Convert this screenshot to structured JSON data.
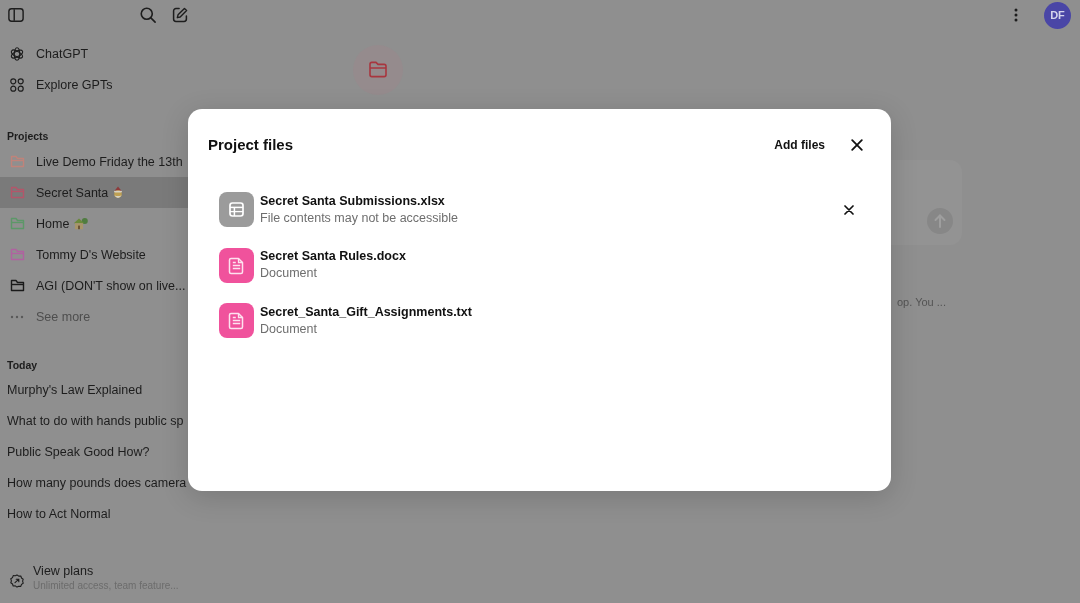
{
  "sidebar": {
    "nav": [
      {
        "label": "ChatGPT",
        "kind": "knot"
      },
      {
        "label": "Explore GPTs",
        "kind": "grid"
      }
    ],
    "projects": {
      "heading": "Projects",
      "items": [
        {
          "name": "Live Demo Friday the 13th",
          "color": "#c0837a",
          "selected": false,
          "kind": "plain"
        },
        {
          "name": "Secret Santa",
          "color": "#b3566a",
          "selected": true,
          "kind": "santa"
        },
        {
          "name": "Home",
          "color": "#5c9868",
          "selected": false,
          "kind": "house"
        },
        {
          "name": "Tommy D's Website",
          "color": "#b062a0",
          "selected": false,
          "kind": "plain"
        },
        {
          "name": "AGI (DON'T show on live...",
          "color": "#1a1a1a",
          "selected": false,
          "kind": "plain"
        }
      ],
      "see_more": "See more"
    },
    "today": {
      "heading": "Today",
      "items": [
        "Murphy's Law Explained",
        "What to do with hands public sp",
        "Public Speak Good How?",
        "How many pounds does camera",
        "How to Act Normal"
      ]
    },
    "plans": {
      "title": "View plans",
      "subtitle": "Unlimited access, team feature..."
    }
  },
  "header": {
    "avatar": "DF"
  },
  "background": {
    "snippet": "op. You ..."
  },
  "modal": {
    "title": "Project files",
    "add_button": "Add files",
    "files": [
      {
        "name": "Secret Santa Submissions.xlsx",
        "detail": "File contents may not be accessible",
        "kind": "spreadsheet",
        "hovered": true
      },
      {
        "name": "Secret Santa Rules.docx",
        "detail": "Document",
        "kind": "document",
        "hovered": false
      },
      {
        "name": "Secret_Santa_Gift_Assignments.txt",
        "detail": "Document",
        "kind": "document",
        "hovered": false
      }
    ]
  }
}
